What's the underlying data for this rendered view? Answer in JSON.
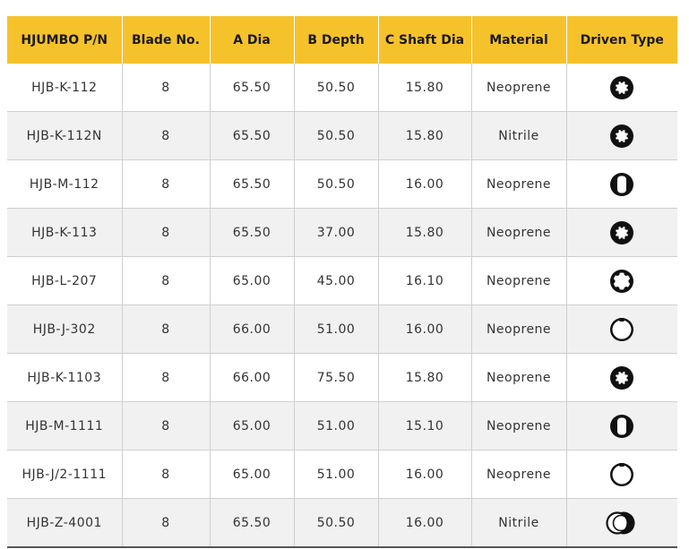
{
  "columns": [
    "HJUMBO P/N",
    "Blade No.",
    "A Dia",
    "B Depth",
    "C Shaft Dia",
    "Material",
    "Driven Type"
  ],
  "rows": [
    {
      "pn": "HJB-K-112",
      "blade": "8",
      "a": "65.50",
      "b": "50.50",
      "c": "15.80",
      "material": "Neoprene",
      "driven_icon": "gear-circle-icon"
    },
    {
      "pn": "HJB-K-112N",
      "blade": "8",
      "a": "65.50",
      "b": "50.50",
      "c": "15.80",
      "material": "Nitrile",
      "driven_icon": "gear-circle-icon"
    },
    {
      "pn": "HJB-M-112",
      "blade": "8",
      "a": "65.50",
      "b": "50.50",
      "c": "16.00",
      "material": "Neoprene",
      "driven_icon": "double-flat-icon"
    },
    {
      "pn": "HJB-K-113",
      "blade": "8",
      "a": "65.50",
      "b": "37.00",
      "c": "15.80",
      "material": "Neoprene",
      "driven_icon": "gear-circle-icon"
    },
    {
      "pn": "HJB-L-207",
      "blade": "8",
      "a": "65.00",
      "b": "45.00",
      "c": "16.10",
      "material": "Neoprene",
      "driven_icon": "spline-ring-icon"
    },
    {
      "pn": "HJB-J-302",
      "blade": "8",
      "a": "66.00",
      "b": "51.00",
      "c": "16.00",
      "material": "Neoprene",
      "driven_icon": "keyed-ring-icon"
    },
    {
      "pn": "HJB-K-1103",
      "blade": "8",
      "a": "66.00",
      "b": "75.50",
      "c": "15.80",
      "material": "Neoprene",
      "driven_icon": "gear-circle-icon"
    },
    {
      "pn": "HJB-M-1111",
      "blade": "8",
      "a": "65.00",
      "b": "51.00",
      "c": "15.10",
      "material": "Neoprene",
      "driven_icon": "double-flat-icon"
    },
    {
      "pn": "HJB-J/2-1111",
      "blade": "8",
      "a": "65.00",
      "b": "51.00",
      "c": "16.00",
      "material": "Neoprene",
      "driven_icon": "keyed-ring-icon"
    },
    {
      "pn": "HJB-Z-4001",
      "blade": "8",
      "a": "65.50",
      "b": "50.50",
      "c": "16.00",
      "material": "Nitrile",
      "driven_icon": "offset-circles-icon"
    }
  ],
  "colors": {
    "header_bg": "#f6c22c",
    "alt_row_bg": "#f1f1f1",
    "grid": "#cfcfcf"
  }
}
